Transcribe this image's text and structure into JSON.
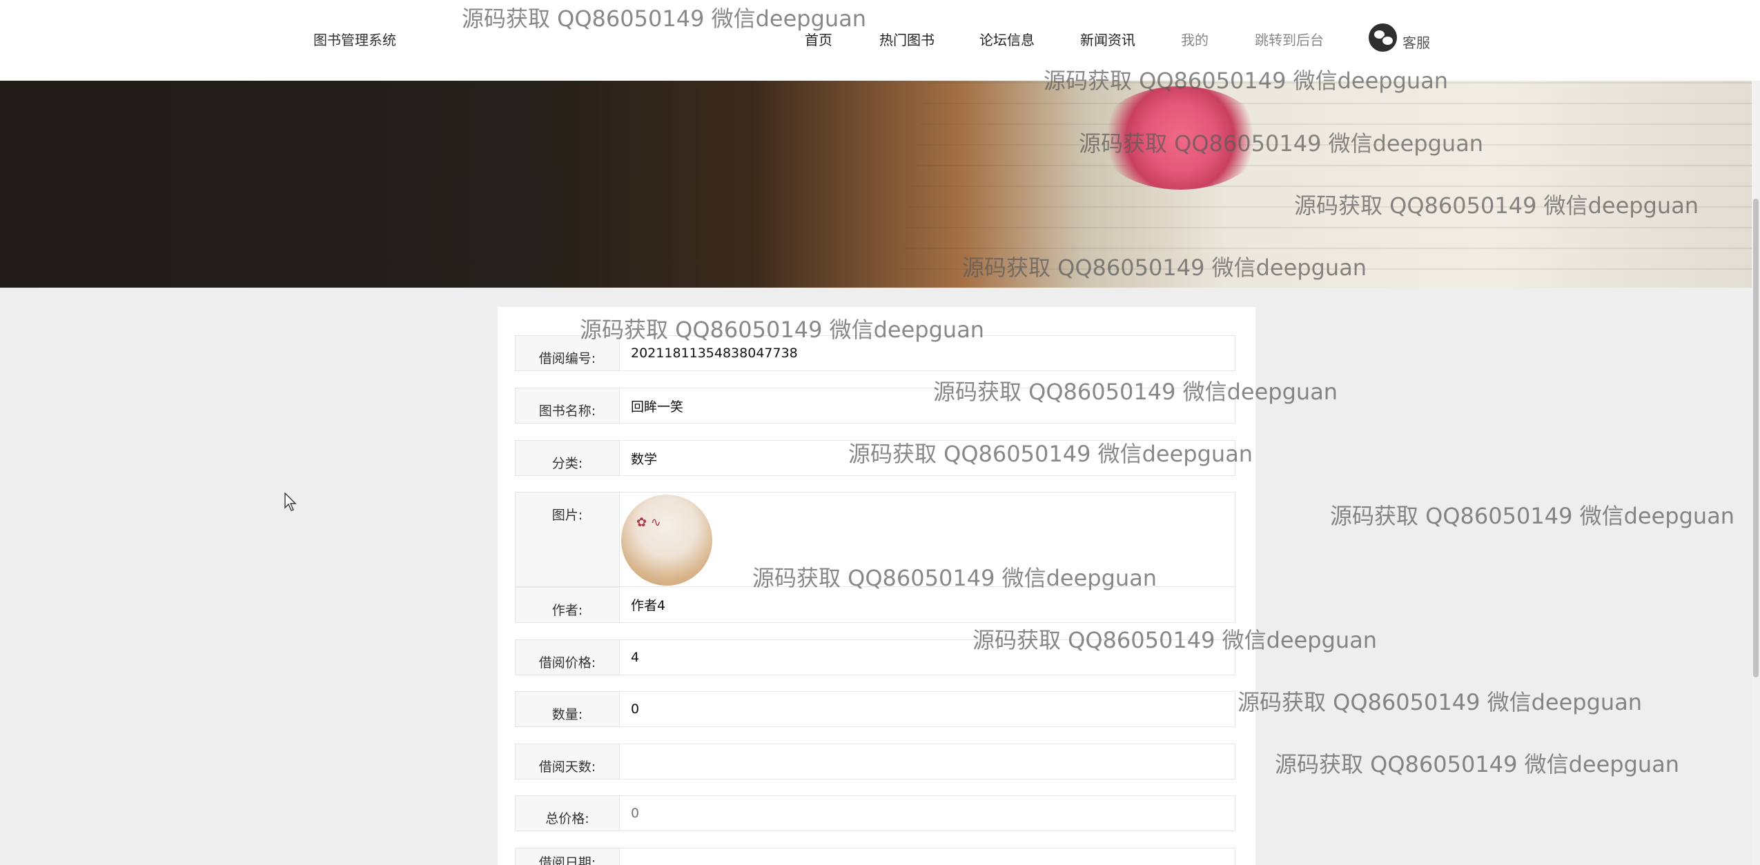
{
  "header": {
    "brand": "图书管理系统",
    "nav": [
      {
        "label": "首页"
      },
      {
        "label": "热门图书"
      },
      {
        "label": "论坛信息"
      },
      {
        "label": "新闻资讯"
      },
      {
        "label": "我的"
      },
      {
        "label": "跳转到后台"
      }
    ],
    "service_label": "客服"
  },
  "form": {
    "rows": [
      {
        "label": "借阅编号:",
        "value": "20211811354838047738"
      },
      {
        "label": "图书名称:",
        "value": "回眸一笑"
      },
      {
        "label": "分类:",
        "value": "数学"
      },
      {
        "label": "图片:",
        "value": ""
      },
      {
        "label": "作者:",
        "value": "作者4"
      },
      {
        "label": "借阅价格:",
        "value": "4"
      },
      {
        "label": "数量:",
        "value": "0"
      },
      {
        "label": "借阅天数:",
        "value": ""
      },
      {
        "label": "总价格:",
        "value": "0"
      },
      {
        "label": "借阅日期:",
        "value": ""
      }
    ]
  },
  "watermark": "源码获取 QQ86050149 微信deepguan",
  "colors": {
    "page_bg": "#eeeeee",
    "panel_bg": "#ffffff",
    "label_bg": "#f7f7f7",
    "border": "#e6e6e6"
  }
}
